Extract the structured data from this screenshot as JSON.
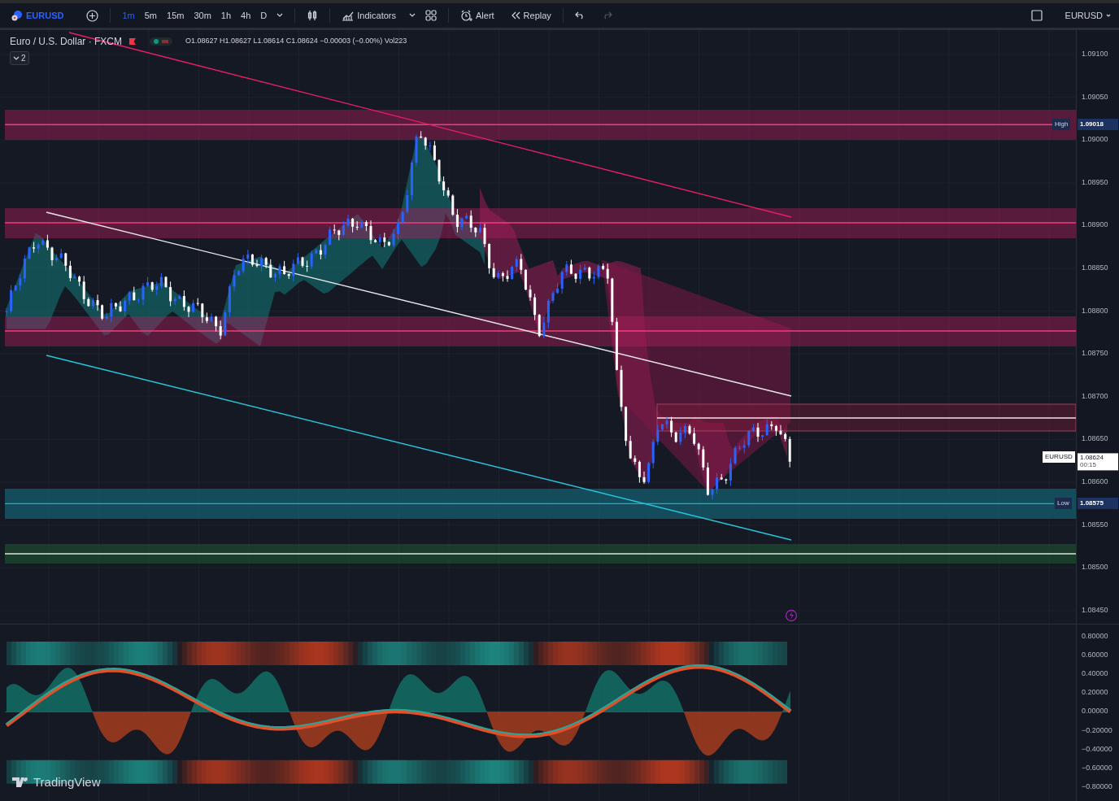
{
  "toolbar": {
    "symbol": "EURUSD",
    "timeframes": [
      {
        "label": "1m",
        "selected": true
      },
      {
        "label": "5m",
        "selected": false
      },
      {
        "label": "15m",
        "selected": false
      },
      {
        "label": "30m",
        "selected": false
      },
      {
        "label": "1h",
        "selected": false
      },
      {
        "label": "4h",
        "selected": false
      },
      {
        "label": "D",
        "selected": false
      }
    ],
    "indicators_label": "Indicators",
    "alert_label": "Alert",
    "replay_label": "Replay",
    "checkbox": {
      "checked": false
    },
    "right_symbol": "EURUSD"
  },
  "legend": {
    "title": "Euro / U.S. Dollar · FXCM",
    "ohlc": "O1.08627 H1.08627 L1.08614 C1.08624 −0.00003 (−0.00%) Vol223",
    "collapsed_count": "2"
  },
  "price_axis": {
    "ticks": [
      "1.09100",
      "1.09050",
      "1.09000",
      "1.08950",
      "1.08900",
      "1.08850",
      "1.08800",
      "1.08750",
      "1.08700",
      "1.08650",
      "1.08600",
      "1.08550",
      "1.08500",
      "1.08450"
    ],
    "high": {
      "label": "High",
      "value": "1.09018"
    },
    "low": {
      "label": "Low",
      "value": "1.08575"
    },
    "last": {
      "symbol": "EURUSD",
      "value": "1.08624",
      "countdown": "00:15"
    }
  },
  "indicator_axis": {
    "ticks": [
      "0.80000",
      "0.60000",
      "0.40000",
      "0.20000",
      "0.00000",
      "−0.20000",
      "−0.40000",
      "−0.60000",
      "−0.80000"
    ]
  },
  "branding": "TradingView"
}
